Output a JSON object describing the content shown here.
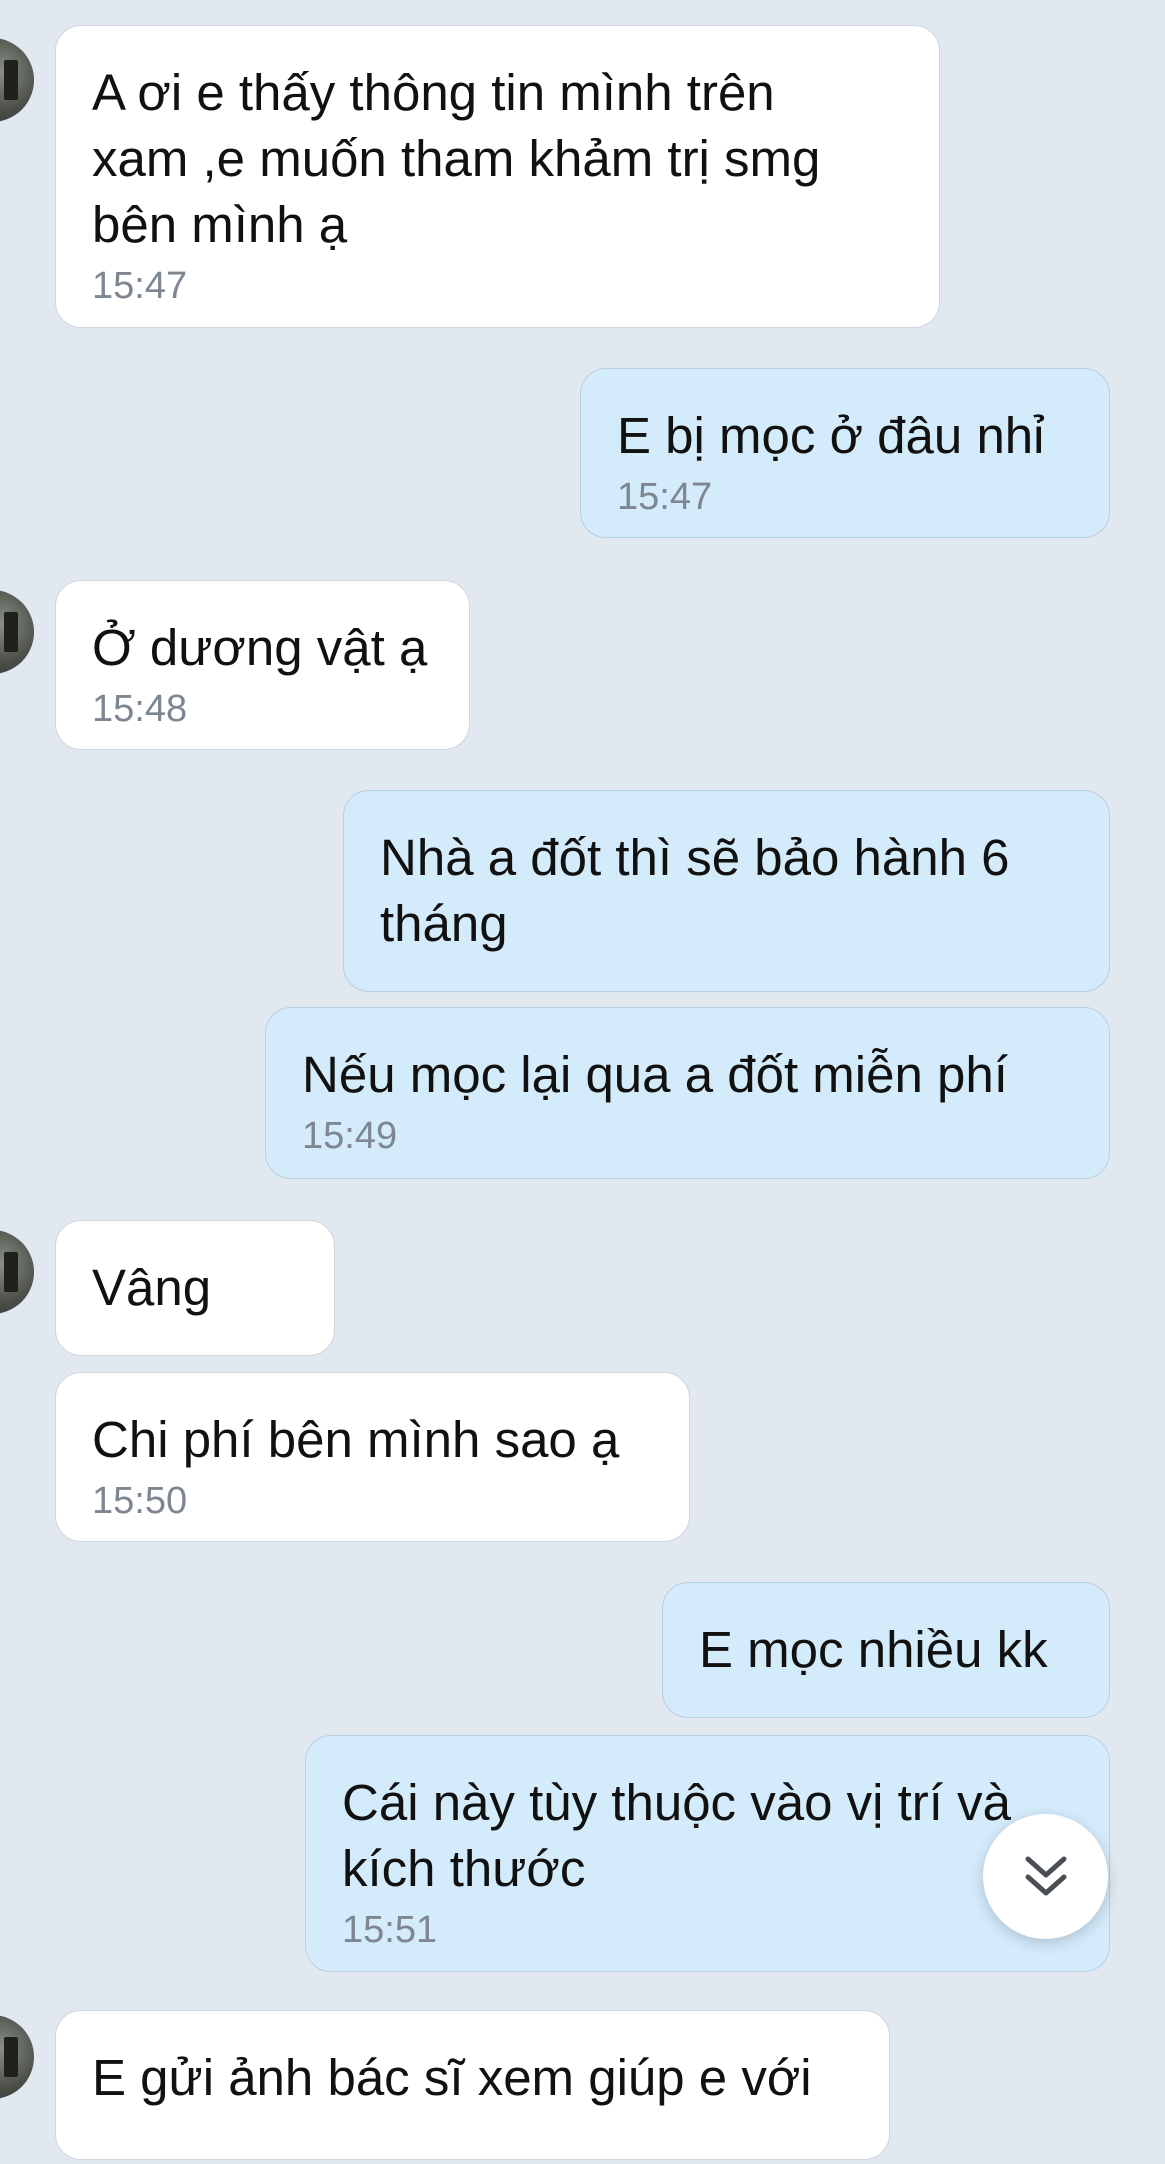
{
  "messages": [
    {
      "direction": "in",
      "text": "A ơi e thấy thông tin mình trên\nxam ,e muốn tham khảm trị smg\nbên mình ạ",
      "time": "15:47"
    },
    {
      "direction": "out",
      "text": "E bị mọc ở đâu nhỉ",
      "time": "15:47"
    },
    {
      "direction": "in",
      "text": "Ở dương vật ạ",
      "time": "15:48"
    },
    {
      "direction": "out",
      "text": "Nhà a đốt thì sẽ bảo hành 6\ntháng",
      "time": ""
    },
    {
      "direction": "out",
      "text": "Nếu mọc lại qua a đốt miễn phí",
      "time": "15:49"
    },
    {
      "direction": "in",
      "text": "Vâng",
      "time": ""
    },
    {
      "direction": "in",
      "text": "Chi phí bên mình sao ạ",
      "time": "15:50"
    },
    {
      "direction": "out",
      "text": "E mọc nhiều kk",
      "time": ""
    },
    {
      "direction": "out",
      "text": "Cái này tùy thuộc vào vị trí và\nkích thước",
      "time": "15:51"
    },
    {
      "direction": "in",
      "text": "E gửi ảnh bác sĩ xem giúp e với",
      "time": ""
    }
  ],
  "scroll_button": {
    "icon": "double-chevron-down-icon"
  },
  "colors": {
    "background": "#e2e8f0",
    "incoming_bubble": "#ffffff",
    "outgoing_bubble": "#d4ebfb",
    "timestamp": "#7e8791"
  }
}
